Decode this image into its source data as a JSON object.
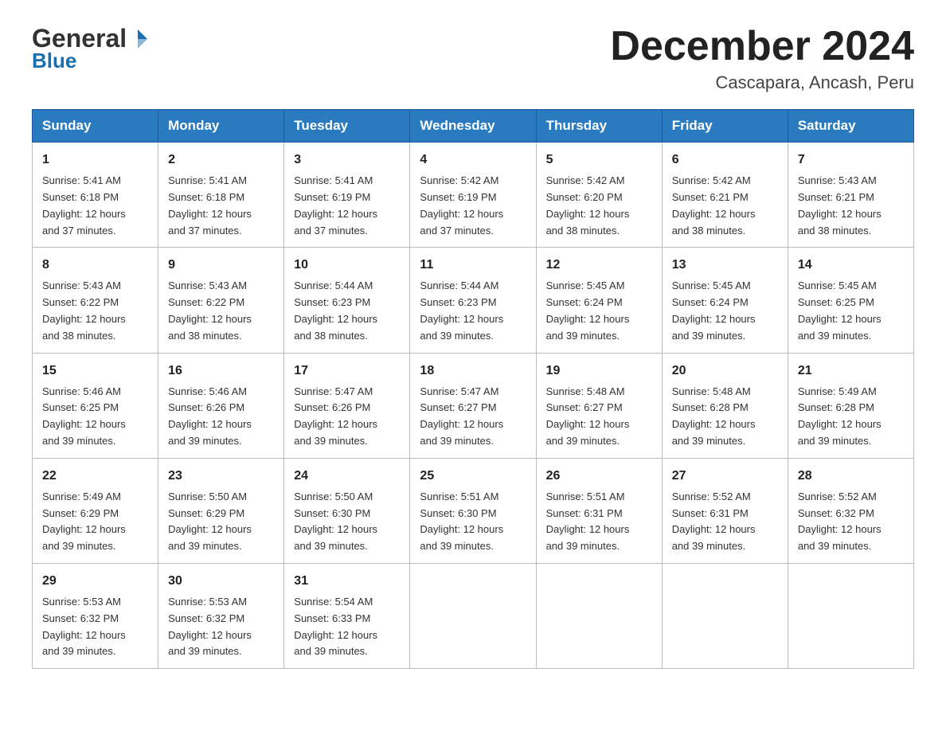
{
  "header": {
    "logo_general": "General",
    "logo_blue": "Blue",
    "month_title": "December 2024",
    "location": "Cascapara, Ancash, Peru"
  },
  "days_of_week": [
    "Sunday",
    "Monday",
    "Tuesday",
    "Wednesday",
    "Thursday",
    "Friday",
    "Saturday"
  ],
  "weeks": [
    [
      {
        "day": "1",
        "sunrise": "5:41 AM",
        "sunset": "6:18 PM",
        "daylight": "12 hours and 37 minutes."
      },
      {
        "day": "2",
        "sunrise": "5:41 AM",
        "sunset": "6:18 PM",
        "daylight": "12 hours and 37 minutes."
      },
      {
        "day": "3",
        "sunrise": "5:41 AM",
        "sunset": "6:19 PM",
        "daylight": "12 hours and 37 minutes."
      },
      {
        "day": "4",
        "sunrise": "5:42 AM",
        "sunset": "6:19 PM",
        "daylight": "12 hours and 37 minutes."
      },
      {
        "day": "5",
        "sunrise": "5:42 AM",
        "sunset": "6:20 PM",
        "daylight": "12 hours and 38 minutes."
      },
      {
        "day": "6",
        "sunrise": "5:42 AM",
        "sunset": "6:21 PM",
        "daylight": "12 hours and 38 minutes."
      },
      {
        "day": "7",
        "sunrise": "5:43 AM",
        "sunset": "6:21 PM",
        "daylight": "12 hours and 38 minutes."
      }
    ],
    [
      {
        "day": "8",
        "sunrise": "5:43 AM",
        "sunset": "6:22 PM",
        "daylight": "12 hours and 38 minutes."
      },
      {
        "day": "9",
        "sunrise": "5:43 AM",
        "sunset": "6:22 PM",
        "daylight": "12 hours and 38 minutes."
      },
      {
        "day": "10",
        "sunrise": "5:44 AM",
        "sunset": "6:23 PM",
        "daylight": "12 hours and 38 minutes."
      },
      {
        "day": "11",
        "sunrise": "5:44 AM",
        "sunset": "6:23 PM",
        "daylight": "12 hours and 39 minutes."
      },
      {
        "day": "12",
        "sunrise": "5:45 AM",
        "sunset": "6:24 PM",
        "daylight": "12 hours and 39 minutes."
      },
      {
        "day": "13",
        "sunrise": "5:45 AM",
        "sunset": "6:24 PM",
        "daylight": "12 hours and 39 minutes."
      },
      {
        "day": "14",
        "sunrise": "5:45 AM",
        "sunset": "6:25 PM",
        "daylight": "12 hours and 39 minutes."
      }
    ],
    [
      {
        "day": "15",
        "sunrise": "5:46 AM",
        "sunset": "6:25 PM",
        "daylight": "12 hours and 39 minutes."
      },
      {
        "day": "16",
        "sunrise": "5:46 AM",
        "sunset": "6:26 PM",
        "daylight": "12 hours and 39 minutes."
      },
      {
        "day": "17",
        "sunrise": "5:47 AM",
        "sunset": "6:26 PM",
        "daylight": "12 hours and 39 minutes."
      },
      {
        "day": "18",
        "sunrise": "5:47 AM",
        "sunset": "6:27 PM",
        "daylight": "12 hours and 39 minutes."
      },
      {
        "day": "19",
        "sunrise": "5:48 AM",
        "sunset": "6:27 PM",
        "daylight": "12 hours and 39 minutes."
      },
      {
        "day": "20",
        "sunrise": "5:48 AM",
        "sunset": "6:28 PM",
        "daylight": "12 hours and 39 minutes."
      },
      {
        "day": "21",
        "sunrise": "5:49 AM",
        "sunset": "6:28 PM",
        "daylight": "12 hours and 39 minutes."
      }
    ],
    [
      {
        "day": "22",
        "sunrise": "5:49 AM",
        "sunset": "6:29 PM",
        "daylight": "12 hours and 39 minutes."
      },
      {
        "day": "23",
        "sunrise": "5:50 AM",
        "sunset": "6:29 PM",
        "daylight": "12 hours and 39 minutes."
      },
      {
        "day": "24",
        "sunrise": "5:50 AM",
        "sunset": "6:30 PM",
        "daylight": "12 hours and 39 minutes."
      },
      {
        "day": "25",
        "sunrise": "5:51 AM",
        "sunset": "6:30 PM",
        "daylight": "12 hours and 39 minutes."
      },
      {
        "day": "26",
        "sunrise": "5:51 AM",
        "sunset": "6:31 PM",
        "daylight": "12 hours and 39 minutes."
      },
      {
        "day": "27",
        "sunrise": "5:52 AM",
        "sunset": "6:31 PM",
        "daylight": "12 hours and 39 minutes."
      },
      {
        "day": "28",
        "sunrise": "5:52 AM",
        "sunset": "6:32 PM",
        "daylight": "12 hours and 39 minutes."
      }
    ],
    [
      {
        "day": "29",
        "sunrise": "5:53 AM",
        "sunset": "6:32 PM",
        "daylight": "12 hours and 39 minutes."
      },
      {
        "day": "30",
        "sunrise": "5:53 AM",
        "sunset": "6:32 PM",
        "daylight": "12 hours and 39 minutes."
      },
      {
        "day": "31",
        "sunrise": "5:54 AM",
        "sunset": "6:33 PM",
        "daylight": "12 hours and 39 minutes."
      },
      null,
      null,
      null,
      null
    ]
  ],
  "labels": {
    "sunrise": "Sunrise:",
    "sunset": "Sunset:",
    "daylight": "Daylight:"
  }
}
